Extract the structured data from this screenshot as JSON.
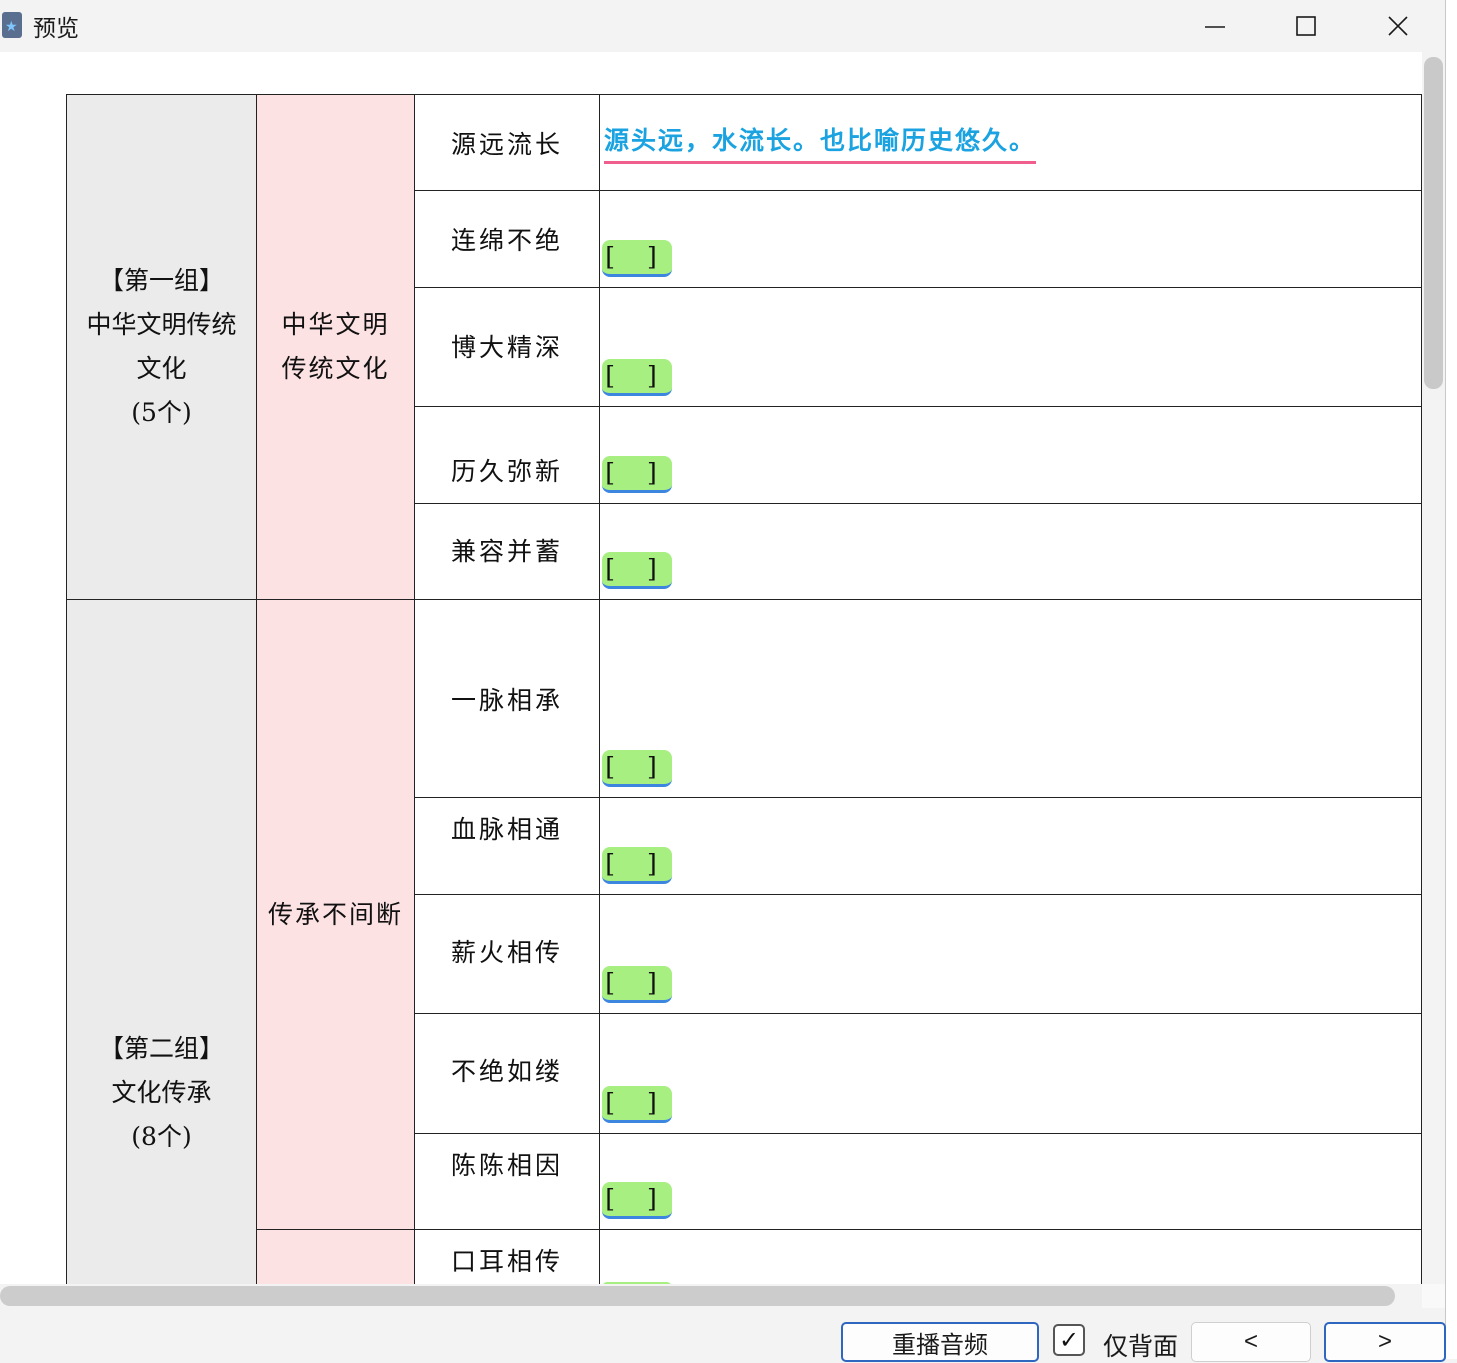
{
  "window": {
    "title": "预览"
  },
  "table": {
    "groups": [
      {
        "label": "【第一组】",
        "name_line1": "中华文明传统",
        "name_line2": "文化",
        "count": "(5个)"
      },
      {
        "label": "【第二组】",
        "name_line1": "文化传承",
        "count": "(8个)"
      }
    ],
    "categories": [
      {
        "line1": "中华文明",
        "line2": "传统文化"
      },
      {
        "line1": "传承不间断"
      }
    ],
    "terms": [
      {
        "term": "源远流长",
        "answer": "源头远，水流长。也比喻历史悠久。"
      },
      {
        "term": "连绵不绝",
        "blank": "[ ]"
      },
      {
        "term": "博大精深",
        "blank": "[ ]"
      },
      {
        "term": "历久弥新",
        "blank": "[ ]"
      },
      {
        "term": "兼容并蓄",
        "blank": "[ ]"
      },
      {
        "term": "一脉相承",
        "blank": "[ ]"
      },
      {
        "term": "血脉相通",
        "blank": "[ ]"
      },
      {
        "term": "薪火相传",
        "blank": "[ ]"
      },
      {
        "term": "不绝如缕",
        "blank": "[ ]"
      },
      {
        "term": "陈陈相因",
        "blank": "[ ]"
      },
      {
        "term": "口耳相传"
      }
    ]
  },
  "bottom": {
    "replay_label": "重播音频",
    "back_only_label": "仅背面",
    "back_only_checked": true,
    "prev_label": "<",
    "next_label": ">"
  },
  "colors": {
    "answer_text": "#1aa3e0",
    "answer_underline": "#ef5e8c",
    "blank_fill": "#a7ef80",
    "blank_border": "#3d86e0",
    "group_bg": "#ebebeb",
    "category_bg": "#fde2e3"
  }
}
